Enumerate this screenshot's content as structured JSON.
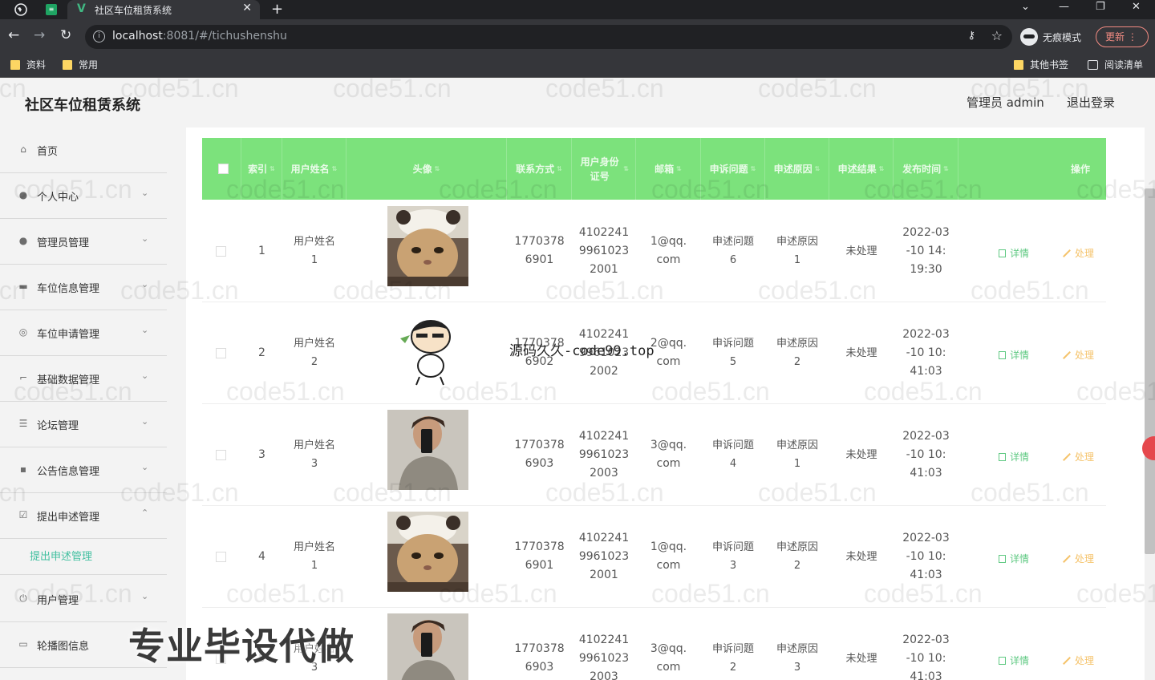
{
  "browser": {
    "tab_title": "社区车位租赁系统",
    "url_host": "localhost",
    "url_rest": ":8081/#/tichushenshu",
    "incognito_label": "无痕模式",
    "update_label": "更新",
    "bookmarks": [
      "资料",
      "常用"
    ],
    "bookmarks_right": [
      "其他书签",
      "阅读清单"
    ]
  },
  "header": {
    "title": "社区车位租赁系统",
    "user": "管理员 admin",
    "logout": "退出登录"
  },
  "sidebar": {
    "items": [
      {
        "label": "首页",
        "icon": "home-icon"
      },
      {
        "label": "个人中心",
        "icon": "user-icon"
      },
      {
        "label": "管理员管理",
        "icon": "user-icon"
      },
      {
        "label": "车位信息管理",
        "icon": "document-icon"
      },
      {
        "label": "车位申请管理",
        "icon": "compass-icon"
      },
      {
        "label": "基础数据管理",
        "icon": "crop-icon"
      },
      {
        "label": "论坛管理",
        "icon": "sliders-icon"
      },
      {
        "label": "公告信息管理",
        "icon": "message-icon"
      },
      {
        "label": "提出申述管理",
        "icon": "check-icon"
      },
      {
        "label": "用户管理",
        "icon": "power-icon"
      },
      {
        "label": "轮播图信息",
        "icon": "chat-icon"
      }
    ],
    "submenu_label": "提出申述管理"
  },
  "table": {
    "columns": [
      "索引",
      "用户姓名",
      "头像",
      "联系方式",
      "用户身份证号",
      "邮箱",
      "申诉问题",
      "申述原因",
      "申述结果",
      "发布时间",
      "操作"
    ],
    "rows": [
      {
        "index": "1",
        "name": "用户姓名1",
        "phone": "17703786901",
        "idcard": "410224199610232001",
        "email": "1@qq.com",
        "issue": "申述问题6",
        "reason": "申述原因1",
        "result": "未处理",
        "time": "2022-03-10 14:19:30",
        "avatar": "cat"
      },
      {
        "index": "2",
        "name": "用户姓名2",
        "phone": "17703786902",
        "idcard": "410224199610232002",
        "email": "2@qq.com",
        "issue": "申诉问题5",
        "reason": "申述原因2",
        "result": "未处理",
        "time": "2022-03-10 10:41:03",
        "avatar": "cartoon"
      },
      {
        "index": "3",
        "name": "用户姓名3",
        "phone": "17703786903",
        "idcard": "410224199610232003",
        "email": "3@qq.com",
        "issue": "申诉问题4",
        "reason": "申述原因1",
        "result": "未处理",
        "time": "2022-03-10 10:41:03",
        "avatar": "person"
      },
      {
        "index": "4",
        "name": "用户姓名1",
        "phone": "17703786901",
        "idcard": "410224199610232001",
        "email": "1@qq.com",
        "issue": "申诉问题3",
        "reason": "申述原因2",
        "result": "未处理",
        "time": "2022-03-10 10:41:03",
        "avatar": "cat"
      },
      {
        "index": "5",
        "name": "用户姓名3",
        "phone": "17703786903",
        "idcard": "410224199610232003",
        "email": "3@qq.com",
        "issue": "申诉问题2",
        "reason": "申述原因3",
        "result": "未处理",
        "time": "2022-03-10 10:41:03",
        "avatar": "person"
      }
    ],
    "action_detail": "详情",
    "action_handle": "处理"
  },
  "overlays": {
    "site_text": "源码久久-code99.top",
    "promo_text": "专业毕设代做",
    "watermark": "code51.cn"
  },
  "colors": {
    "header_green": "#7ce27c",
    "accent_teal": "#44c0a1",
    "detail_green": "#5fc982",
    "handle_orange": "#f5c36b"
  }
}
